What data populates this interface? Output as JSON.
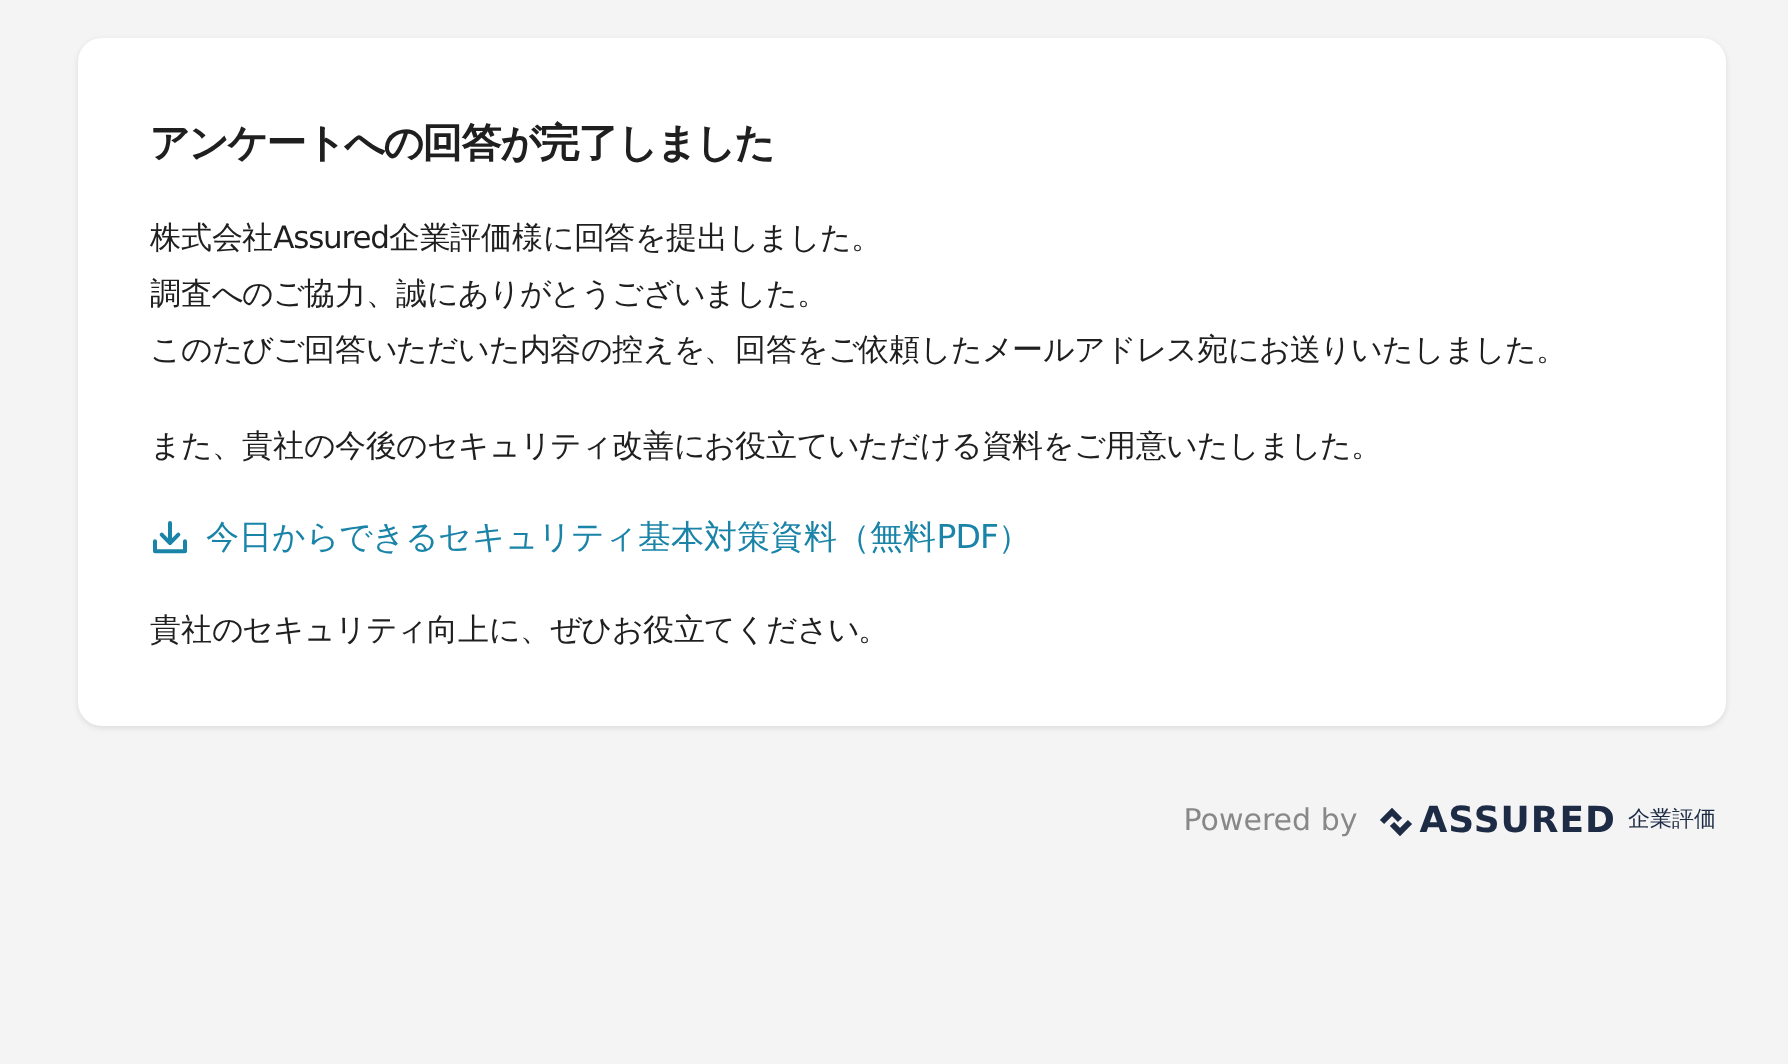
{
  "card": {
    "title": "アンケートへの回答が完了しました",
    "message_lines": [
      "株式会社Assured企業評価様に回答を提出しました。",
      "調査へのご協力、誠にありがとうございました。",
      "このたびご回答いただいた内容の控えを、回答をご依頼したメールアドレス宛にお送りいたしました。"
    ],
    "offer": "また、貴社の今後のセキュリティ改善にお役立ていただける資料をご用意いたしました。",
    "download_link": "今日からできるセキュリティ基本対策資料（無料PDF）",
    "closing": "貴社のセキュリティ向上に、ぜひお役立てください。"
  },
  "footer": {
    "powered_by": "Powered by",
    "brand": "ASSURED",
    "brand_sub": "企業評価"
  }
}
